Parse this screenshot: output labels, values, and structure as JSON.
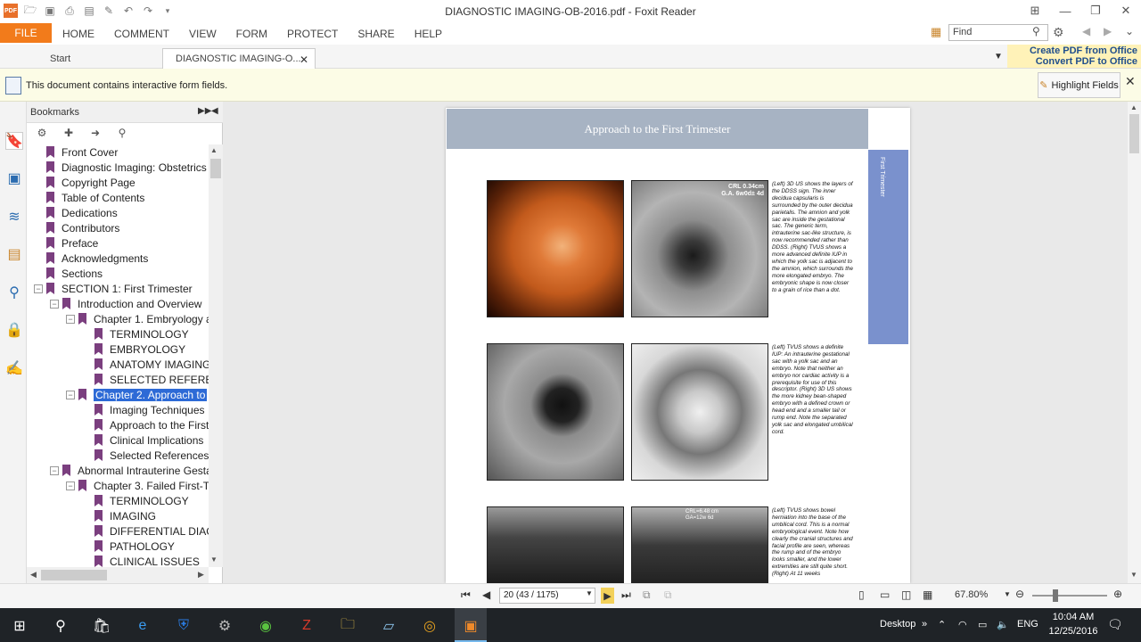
{
  "app": {
    "title": "DIAGNOSTIC IMAGING-OB-2016.pdf - Foxit Reader"
  },
  "ribbon": {
    "file": "FILE",
    "menu": [
      "HOME",
      "COMMENT",
      "VIEW",
      "FORM",
      "PROTECT",
      "SHARE",
      "HELP"
    ],
    "find_placeholder": "Find",
    "ad_line1": "Create PDF from Office",
    "ad_line2": "Convert PDF to Office"
  },
  "tabs": {
    "start": "Start",
    "doc": "DIAGNOSTIC IMAGING-O..."
  },
  "notice": {
    "text": "This document contains interactive form fields.",
    "button": "Highlight Fields"
  },
  "bookmarks": {
    "title": "Bookmarks",
    "items": [
      {
        "label": "Front Cover",
        "level": 0
      },
      {
        "label": "Diagnostic Imaging: Obstetrics",
        "level": 0
      },
      {
        "label": "Copyright Page",
        "level": 0
      },
      {
        "label": "Table of Contents",
        "level": 0
      },
      {
        "label": "Dedications",
        "level": 0
      },
      {
        "label": "Contributors",
        "level": 0
      },
      {
        "label": "Preface",
        "level": 0
      },
      {
        "label": "Acknowledgments",
        "level": 0
      },
      {
        "label": "Sections",
        "level": 0
      },
      {
        "label": "SECTION 1: First Trimester",
        "level": 0,
        "toggle": "⊟"
      },
      {
        "label": "Introduction and Overview",
        "level": 1,
        "toggle": "⊟"
      },
      {
        "label": "Chapter 1. Embryology a",
        "level": 2,
        "toggle": "⊟"
      },
      {
        "label": "TERMINOLOGY",
        "level": 3
      },
      {
        "label": "EMBRYOLOGY",
        "level": 3
      },
      {
        "label": "ANATOMY IMAGING",
        "level": 3
      },
      {
        "label": "SELECTED REFERENC",
        "level": 3
      },
      {
        "label": "Chapter 2. Approach to",
        "level": 2,
        "toggle": "⊟",
        "selected": true
      },
      {
        "label": "Imaging Techniques",
        "level": 3
      },
      {
        "label": "Approach to the First",
        "level": 3
      },
      {
        "label": "Clinical Implications",
        "level": 3
      },
      {
        "label": "Selected References",
        "level": 3
      },
      {
        "label": "Abnormal Intrauterine Gesta",
        "level": 1,
        "toggle": "⊟"
      },
      {
        "label": "Chapter 3. Failed First-Tr",
        "level": 2,
        "toggle": "⊟"
      },
      {
        "label": "TERMINOLOGY",
        "level": 3
      },
      {
        "label": "IMAGING",
        "level": 3
      },
      {
        "label": "DIFFERENTIAL DIAGN",
        "level": 3
      },
      {
        "label": "PATHOLOGY",
        "level": 3
      },
      {
        "label": "CLINICAL ISSUES",
        "level": 3
      }
    ]
  },
  "page": {
    "header": "Approach to the First Trimester",
    "sidetab": "First Trimester",
    "img1_label": "CRL 0.34cm\nG.A. 6w0d± 4d",
    "img5_label": "CRL=6.48 cm\nGA=12w 6d",
    "captions": [
      "(Left) 3D US shows the layers of the DDSS sign. The inner decidua capsularis is surrounded by the outer decidua parietalis. The amnion and yolk sac are inside the gestational sac. The generic term, intrauterine sac-like structure, is now recommended rather than DDSS. (Right) TVUS shows a more advanced definite IUP in which the yolk sac is adjacent to the amnion, which surrounds the more elongated embryo. The embryonic shape is now closer to a grain of rice than a dot.",
      "(Left) TVUS shows a definite IUP: An intrauterine gestational sac with a yolk sac and an embryo. Note that neither an embryo nor cardiac activity is a prerequisite for use of this descriptor. (Right) 3D US shows the more kidney bean-shaped embryo with a defined crown or head end and a smaller tail or rump end. Note the separated yolk sac and elongated umbilical cord.",
      "(Left) TVUS shows bowel herniation into the base of the umbilical cord. This is a normal embryological event. Note how clearly the cranial structures and facial profile are seen, whereas the rump and of the embryo looks smaller, and the lower extremities are still quite short. (Right) At 11 weeks"
    ]
  },
  "status": {
    "page_field": "20 (43 / 1175)",
    "zoom": "67.80%"
  },
  "taskbar": {
    "desktop": "Desktop",
    "lang": "ENG",
    "time": "10:04 AM",
    "date": "12/25/2016"
  },
  "colors": {
    "file_tab": "#f27b1b",
    "selection": "#2d6ad6",
    "page_header": "#a7b3c3",
    "sidetab": "#7a91cd",
    "bookmark_icon": "#7b3f7f"
  }
}
